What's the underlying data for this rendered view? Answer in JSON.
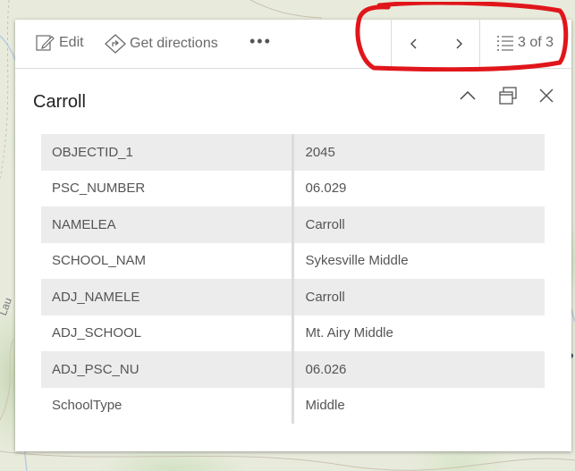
{
  "map": {
    "label": "Lau"
  },
  "toolbar": {
    "edit_label": "Edit",
    "directions_label": "Get directions",
    "more_label": "•••"
  },
  "pager": {
    "count": "3 of 3"
  },
  "feature": {
    "title": "Carroll"
  },
  "fields": [
    {
      "key": "OBJECTID_1",
      "value": "2045"
    },
    {
      "key": "PSC_NUMBER",
      "value": "06.029"
    },
    {
      "key": "NAMELEA",
      "value": "Carroll"
    },
    {
      "key": "SCHOOL_NAM",
      "value": "Sykesville Middle"
    },
    {
      "key": "ADJ_NAMELE",
      "value": "Carroll"
    },
    {
      "key": "ADJ_SCHOOL",
      "value": "Mt. Airy Middle"
    },
    {
      "key": "ADJ_PSC_NU",
      "value": "06.026"
    },
    {
      "key": "SchoolType",
      "value": "Middle"
    }
  ],
  "colors": {
    "annotation": "#e0161b",
    "row_alt": "#ececec",
    "text": "#555555"
  }
}
